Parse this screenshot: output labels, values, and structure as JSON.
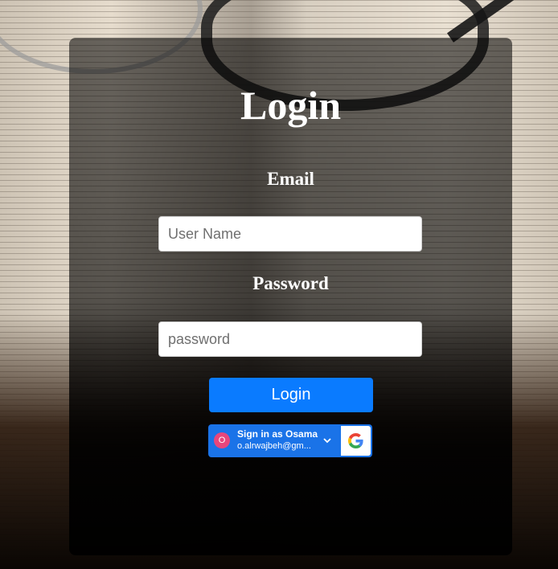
{
  "login": {
    "title": "Login",
    "email_label": "Email",
    "password_label": "Password",
    "username_placeholder": "User Name",
    "password_placeholder": "password",
    "login_button": "Login"
  },
  "google_signin": {
    "avatar_initial": "O",
    "label": "Sign in as Osama",
    "email": "o.alrwajbeh@gm...",
    "icon": "google-logo-icon",
    "dropdown_icon": "chevron-down-icon"
  },
  "colors": {
    "primary": "#0a7bff",
    "google_blue": "#1a73e8",
    "avatar": "#e8467c"
  }
}
